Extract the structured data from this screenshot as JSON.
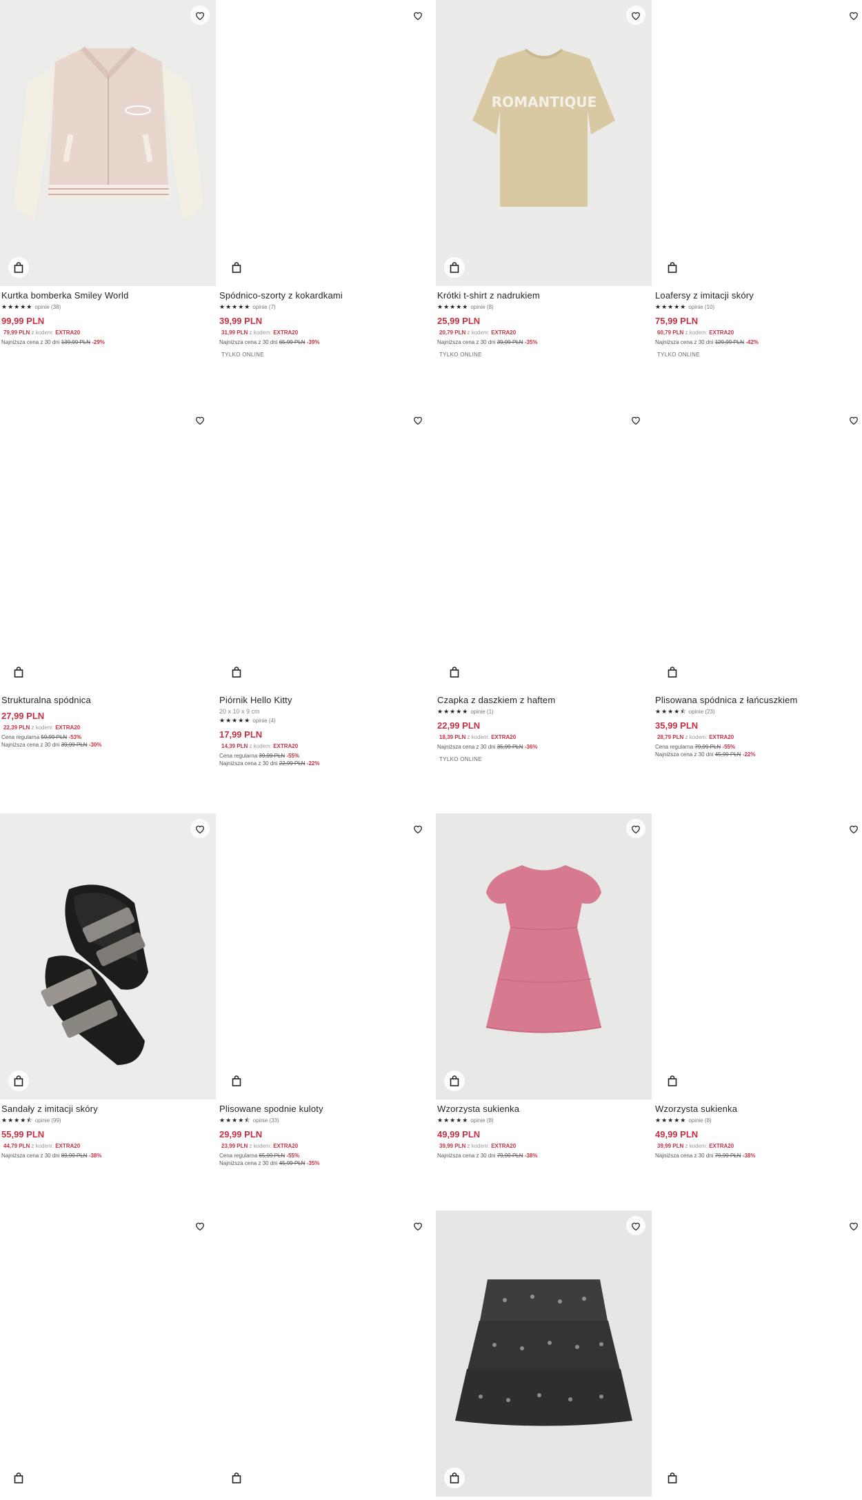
{
  "products": [
    {
      "name": "Kurtka bomberka Smiley World",
      "subtitle": "",
      "stars": "★★★★★",
      "reviews": "opinie (38)",
      "price": "99,99 PLN",
      "promo_price": "79,99 PLN",
      "promo_with": "z kodem:",
      "promo_code": "EXTRA20",
      "regular_label": "",
      "regular_old": "",
      "regular_pct": "",
      "lowest_label": "Najniższa cena z 30 dni",
      "lowest_old": "139,99 PLN",
      "lowest_pct": "-29%",
      "tag": ""
    },
    {
      "name": "Spódnico-szorty z kokardkami",
      "subtitle": "",
      "stars": "★★★★★",
      "reviews": "opinie (7)",
      "price": "39,99 PLN",
      "promo_price": "31,99 PLN",
      "promo_with": "z kodem:",
      "promo_code": "EXTRA20",
      "regular_label": "",
      "regular_old": "",
      "regular_pct": "",
      "lowest_label": "Najniższa cena z 30 dni",
      "lowest_old": "65,99 PLN",
      "lowest_pct": "-39%",
      "tag": "TYLKO ONLINE"
    },
    {
      "name": "Krótki t-shirt z nadrukiem",
      "subtitle": "",
      "stars": "★★★★★",
      "reviews": "opinie (8)",
      "price": "25,99 PLN",
      "promo_price": "20,79 PLN",
      "promo_with": "z kodem:",
      "promo_code": "EXTRA20",
      "regular_label": "",
      "regular_old": "",
      "regular_pct": "",
      "lowest_label": "Najniższa cena z 30 dni",
      "lowest_old": "39,99 PLN",
      "lowest_pct": "-35%",
      "tag": "TYLKO ONLINE"
    },
    {
      "name": "Loafersy z imitacji skóry",
      "subtitle": "",
      "stars": "★★★★★",
      "reviews": "opinie (10)",
      "price": "75,99 PLN",
      "promo_price": "60,79 PLN",
      "promo_with": "z kodem:",
      "promo_code": "EXTRA20",
      "regular_label": "",
      "regular_old": "",
      "regular_pct": "",
      "lowest_label": "Najniższa cena z 30 dni",
      "lowest_old": "129,99 PLN",
      "lowest_pct": "-42%",
      "tag": "TYLKO ONLINE"
    },
    {
      "name": "Strukturalna spódnica",
      "subtitle": "",
      "stars": "",
      "reviews": "",
      "price": "27,99 PLN",
      "promo_price": "22,39 PLN",
      "promo_with": "z kodem:",
      "promo_code": "EXTRA20",
      "regular_label": "Cena regularna",
      "regular_old": "59,99 PLN",
      "regular_pct": "-53%",
      "lowest_label": "Najniższa cena z 30 dni",
      "lowest_old": "39,99 PLN",
      "lowest_pct": "-30%",
      "tag": ""
    },
    {
      "name": "Piórnik Hello Kitty",
      "subtitle": "20 x 10 x 9 cm",
      "stars": "★★★★★",
      "reviews": "opinie (4)",
      "price": "17,99 PLN",
      "promo_price": "14,39 PLN",
      "promo_with": "z kodem:",
      "promo_code": "EXTRA20",
      "regular_label": "Cena regularna",
      "regular_old": "39,99 PLN",
      "regular_pct": "-55%",
      "lowest_label": "Najniższa cena z 30 dni",
      "lowest_old": "22,99 PLN",
      "lowest_pct": "-22%",
      "tag": ""
    },
    {
      "name": "Czapka z daszkiem z haftem",
      "subtitle": "",
      "stars": "★★★★★",
      "reviews": "opinie (1)",
      "price": "22,99 PLN",
      "promo_price": "18,39 PLN",
      "promo_with": "z kodem:",
      "promo_code": "EXTRA20",
      "regular_label": "",
      "regular_old": "",
      "regular_pct": "",
      "lowest_label": "Najniższa cena z 30 dni",
      "lowest_old": "35,99 PLN",
      "lowest_pct": "-36%",
      "tag": "TYLKO ONLINE"
    },
    {
      "name": "Plisowana spódnica z łańcuszkiem",
      "subtitle": "",
      "stars": "★★★★⯪",
      "reviews": "opinie (23)",
      "price": "35,99 PLN",
      "promo_price": "28,79 PLN",
      "promo_with": "z kodem:",
      "promo_code": "EXTRA20",
      "regular_label": "Cena regularna",
      "regular_old": "79,99 PLN",
      "regular_pct": "-55%",
      "lowest_label": "Najniższa cena z 30 dni",
      "lowest_old": "45,99 PLN",
      "lowest_pct": "-22%",
      "tag": ""
    },
    {
      "name": "Sandały z imitacji skóry",
      "subtitle": "",
      "stars": "★★★★⯪",
      "reviews": "opinie (99)",
      "price": "55,99 PLN",
      "promo_price": "44,79 PLN",
      "promo_with": "z kodem:",
      "promo_code": "EXTRA20",
      "regular_label": "",
      "regular_old": "",
      "regular_pct": "",
      "lowest_label": "Najniższa cena z 30 dni",
      "lowest_old": "89,99 PLN",
      "lowest_pct": "-38%",
      "tag": ""
    },
    {
      "name": "Plisowane spodnie kuloty",
      "subtitle": "",
      "stars": "★★★★⯪",
      "reviews": "opinie (33)",
      "price": "29,99 PLN",
      "promo_price": "23,99 PLN",
      "promo_with": "z kodem:",
      "promo_code": "EXTRA20",
      "regular_label": "Cena regularna",
      "regular_old": "65,99 PLN",
      "regular_pct": "-55%",
      "lowest_label": "Najniższa cena z 30 dni",
      "lowest_old": "45,99 PLN",
      "lowest_pct": "-35%",
      "tag": ""
    },
    {
      "name": "Wzorzysta sukienka",
      "subtitle": "",
      "stars": "★★★★★",
      "reviews": "opinie (8)",
      "price": "49,99 PLN",
      "promo_price": "39,99 PLN",
      "promo_with": "z kodem:",
      "promo_code": "EXTRA20",
      "regular_label": "",
      "regular_old": "",
      "regular_pct": "",
      "lowest_label": "Najniższa cena z 30 dni",
      "lowest_old": "79,99 PLN",
      "lowest_pct": "-38%",
      "tag": ""
    },
    {
      "name": "Wzorzysta sukienka",
      "subtitle": "",
      "stars": "★★★★★",
      "reviews": "opinie (8)",
      "price": "49,99 PLN",
      "promo_price": "39,99 PLN",
      "promo_with": "z kodem:",
      "promo_code": "EXTRA20",
      "regular_label": "",
      "regular_old": "",
      "regular_pct": "",
      "lowest_label": "Najniższa cena z 30 dni",
      "lowest_old": "79,99 PLN",
      "lowest_pct": "-38%",
      "tag": ""
    }
  ],
  "tshirt_print": "ROMANTIQUE",
  "colors": {
    "price": "#c63043",
    "image_bg": "#e9e9e9"
  }
}
